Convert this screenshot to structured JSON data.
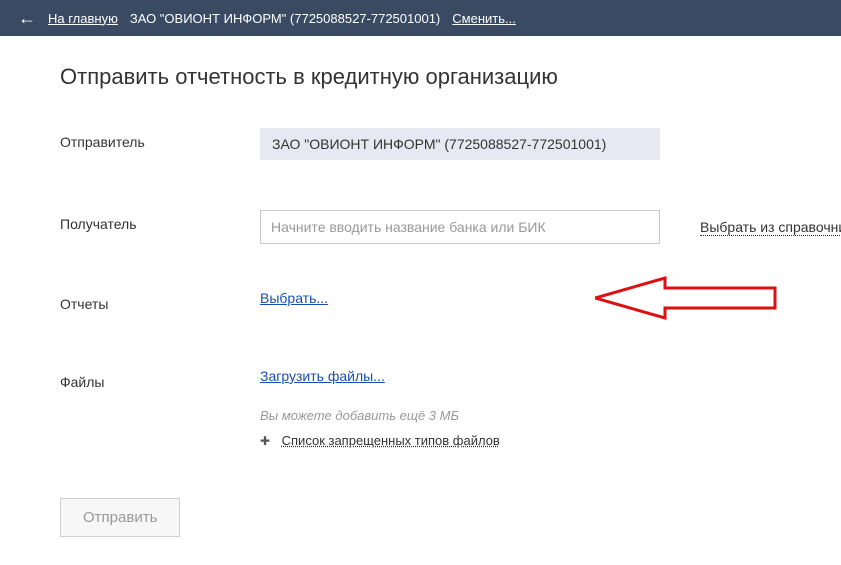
{
  "topbar": {
    "home_link": "На главную",
    "org_name": "ЗАО \"ОВИОНТ ИНФОРМ\" (7725088527-772501001)",
    "change_link": "Сменить..."
  },
  "page_title": "Отправить отчетность в кредитную организацию",
  "form": {
    "sender": {
      "label": "Отправитель",
      "value": "ЗАО \"ОВИОНТ ИНФОРМ\" (7725088527-772501001)"
    },
    "recipient": {
      "label": "Получатель",
      "placeholder": "Начните вводить название банка или БИК",
      "directory_link": "Выбрать из справочника"
    },
    "reports": {
      "label": "Отчеты",
      "select_link": "Выбрать..."
    },
    "files": {
      "label": "Файлы",
      "upload_link": "Загрузить файлы...",
      "hint": "Вы можете добавить ещё 3 МБ",
      "forbidden_link": "Список запрещенных типов файлов"
    },
    "submit_label": "Отправить"
  }
}
